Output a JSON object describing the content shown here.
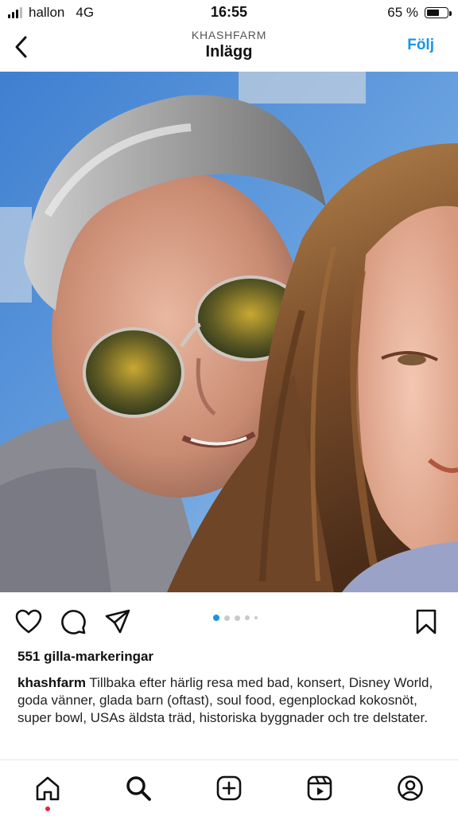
{
  "status_bar": {
    "carrier": "hallon",
    "network": "4G",
    "time": "16:55",
    "battery_percent": "65 %",
    "battery_level": 0.65
  },
  "header": {
    "account_name": "KHASHFARM",
    "title": "Inlägg",
    "follow_label": "Följ"
  },
  "post": {
    "image_alt": "Selfie of a man with grey hair and aviator sunglasses and a girl with long brown hair, blue sky behind",
    "carousel": {
      "total": 5,
      "active": 1
    },
    "likes_text": "551 gilla-markeringar",
    "caption_user": "khashfarm",
    "caption_text": "Tillbaka efter härlig resa med bad, konsert, Disney World, goda vänner, glada barn (oftast), soul food, egenplockad kokosnöt, super bowl, USAs äldsta träd, historiska byggnader och tre delstater."
  },
  "colors": {
    "accent": "#1a94e8",
    "notification": "#e5243b"
  },
  "icons": {
    "actions": [
      "heart-icon",
      "comment-icon",
      "share-icon",
      "bookmark-icon"
    ],
    "tabs": [
      "home-icon",
      "search-icon",
      "create-icon",
      "reels-icon",
      "profile-icon"
    ]
  }
}
